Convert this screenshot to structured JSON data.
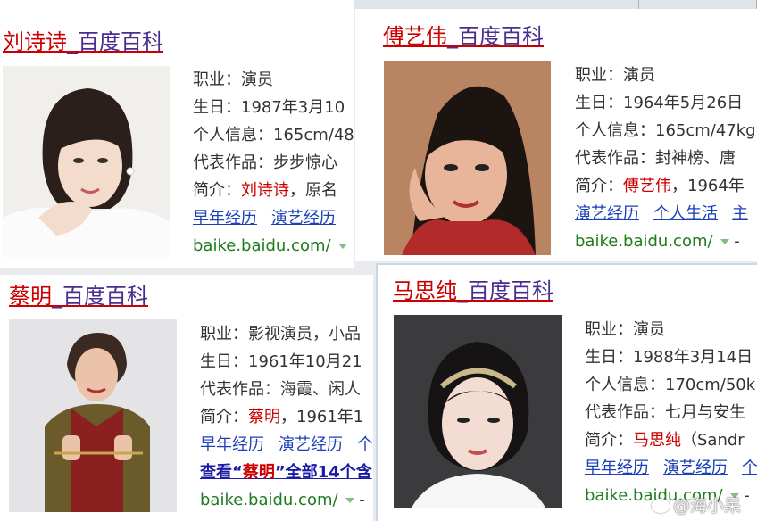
{
  "cards": [
    {
      "name": "刘诗诗",
      "suffix": "_百度百科",
      "lines": [
        "职业：演员",
        "生日：1987年3月10",
        "个人信息：165cm/48",
        "代表作品：步步惊心",
        "简介："
      ],
      "intro_after": "，原名",
      "links": [
        "早年经历",
        "演艺经历"
      ],
      "url": "baike.baidu.com/"
    },
    {
      "name": "傅艺伟",
      "suffix": "_百度百科",
      "lines": [
        "职业：演员",
        "生日：1964年5月26日",
        "个人信息：165cm/47kg",
        "代表作品：封神榜、唐",
        "简介："
      ],
      "intro_after": "，1964年",
      "links": [
        "演艺经历",
        "个人生活",
        "主"
      ],
      "url": "baike.baidu.com/",
      "url_after": "-"
    },
    {
      "name": "蔡明",
      "suffix": "_百度百科",
      "lines": [
        "职业：影视演员，小品",
        "生日：1961年10月21",
        "代表作品：海霞、闲人",
        "简介："
      ],
      "intro_after": "，1961年1",
      "links": [
        "早年经历",
        "演艺经历",
        "个"
      ],
      "more_pre": "查看“",
      "more_post": "”全部14个含",
      "url": "baike.baidu.com/",
      "url_after": "-"
    },
    {
      "name": "马思纯",
      "suffix": "_百度百科",
      "lines": [
        "职业：演员",
        "生日：1988年3月14日",
        "个人信息：170cm/50k",
        "代表作品：七月与安生",
        "简介："
      ],
      "intro_after": "（Sandr",
      "links": [
        "早年经历",
        "演艺经历",
        "个"
      ],
      "url": "baike.baidu.com/",
      "url_after": "-"
    }
  ],
  "watermark": "@海小呆",
  "colors": {
    "title_red": "#cc0000",
    "suffix_purple": "#4a2d8f",
    "link_blue": "#1a3fb8",
    "url_green": "#1e7b1e"
  }
}
